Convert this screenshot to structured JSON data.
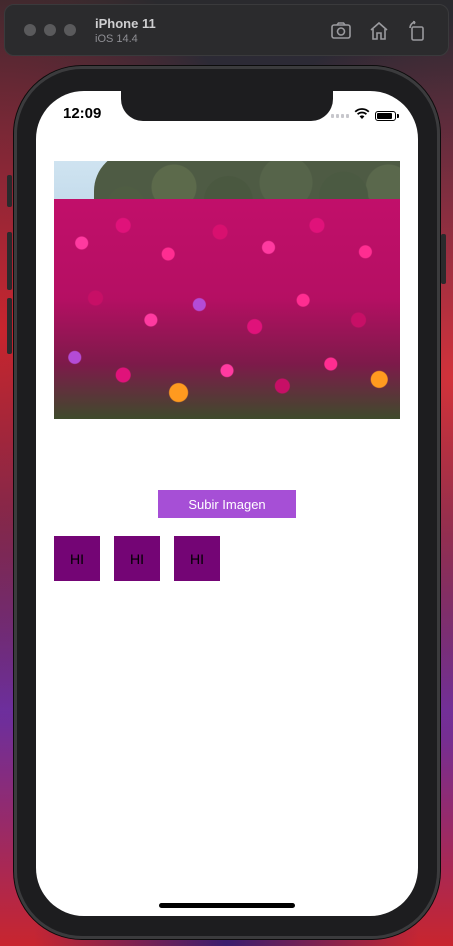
{
  "simulator": {
    "device_name": "iPhone 11",
    "os_version": "iOS 14.4",
    "icons": [
      "screenshot-icon",
      "home-icon",
      "rotate-icon"
    ]
  },
  "status_bar": {
    "time": "12:09"
  },
  "app": {
    "upload_button_label": "Subir Imagen",
    "hi_buttons": [
      "HI",
      "HI",
      "HI"
    ],
    "accent_color": "#a64fd6",
    "hi_button_color": "#740575"
  }
}
